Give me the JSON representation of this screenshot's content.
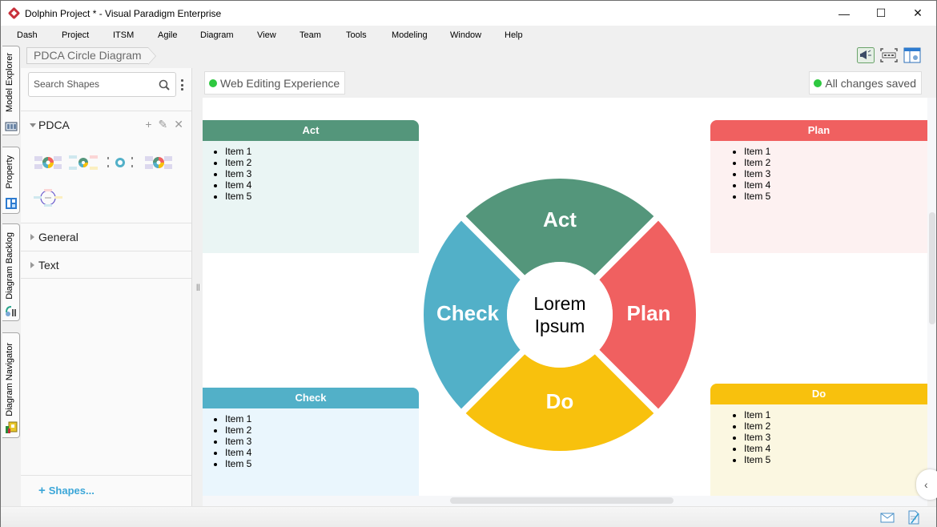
{
  "window": {
    "title": "Dolphin Project * - Visual Paradigm Enterprise",
    "controls": {
      "minimize": "—",
      "maximize": "☐",
      "close": "✕"
    }
  },
  "menu": [
    "Dash",
    "Project",
    "ITSM",
    "Agile",
    "Diagram",
    "View",
    "Team",
    "Tools",
    "Modeling",
    "Window",
    "Help"
  ],
  "side_tabs": [
    "Model Explorer",
    "Property",
    "Diagram Backlog",
    "Diagram Navigator"
  ],
  "breadcrumb": "PDCA Circle Diagram",
  "toolbar_icons": [
    "announcement-icon",
    "fit-diagram-icon",
    "layout-panel-icon"
  ],
  "shape_panel": {
    "search_placeholder": "Search Shapes",
    "categories": [
      {
        "name": "PDCA",
        "expanded": true,
        "actions": [
          "+",
          "✎",
          "✕"
        ],
        "thumbnail_count": 5
      },
      {
        "name": "General",
        "expanded": false
      },
      {
        "name": "Text",
        "expanded": false
      }
    ],
    "add_shapes_label": "Shapes..."
  },
  "canvas_status": {
    "left": "Web Editing Experience",
    "right": "All changes saved",
    "dot_color": "#2ec840"
  },
  "diagram": {
    "center_text": [
      "Lorem",
      "Ipsum"
    ],
    "segments": [
      {
        "label": "Act",
        "color": "#54967b"
      },
      {
        "label": "Plan",
        "color": "#f06060"
      },
      {
        "label": "Do",
        "color": "#f8c10d"
      },
      {
        "label": "Check",
        "color": "#52b0c8"
      }
    ],
    "cards": [
      {
        "title": "Act",
        "header_color": "#54967b",
        "body_color": "#eaf5f4",
        "items": [
          "Item 1",
          "Item 2",
          "Item 3",
          "Item 4",
          "Item 5"
        ]
      },
      {
        "title": "Plan",
        "header_color": "#f06060",
        "body_color": "#fdf1f1",
        "items": [
          "Item 1",
          "Item 2",
          "Item 3",
          "Item 4",
          "Item 5"
        ]
      },
      {
        "title": "Check",
        "header_color": "#52b0c8",
        "body_color": "#eaf6fd",
        "items": [
          "Item 1",
          "Item 2",
          "Item 3",
          "Item 4",
          "Item 5"
        ]
      },
      {
        "title": "Do",
        "header_color": "#f8c10d",
        "body_color": "#fbf7e1",
        "items": [
          "Item 1",
          "Item 2",
          "Item 3",
          "Item 4",
          "Item 5"
        ]
      }
    ]
  },
  "statusbar_icons": [
    "mail-icon",
    "document-edit-icon"
  ]
}
